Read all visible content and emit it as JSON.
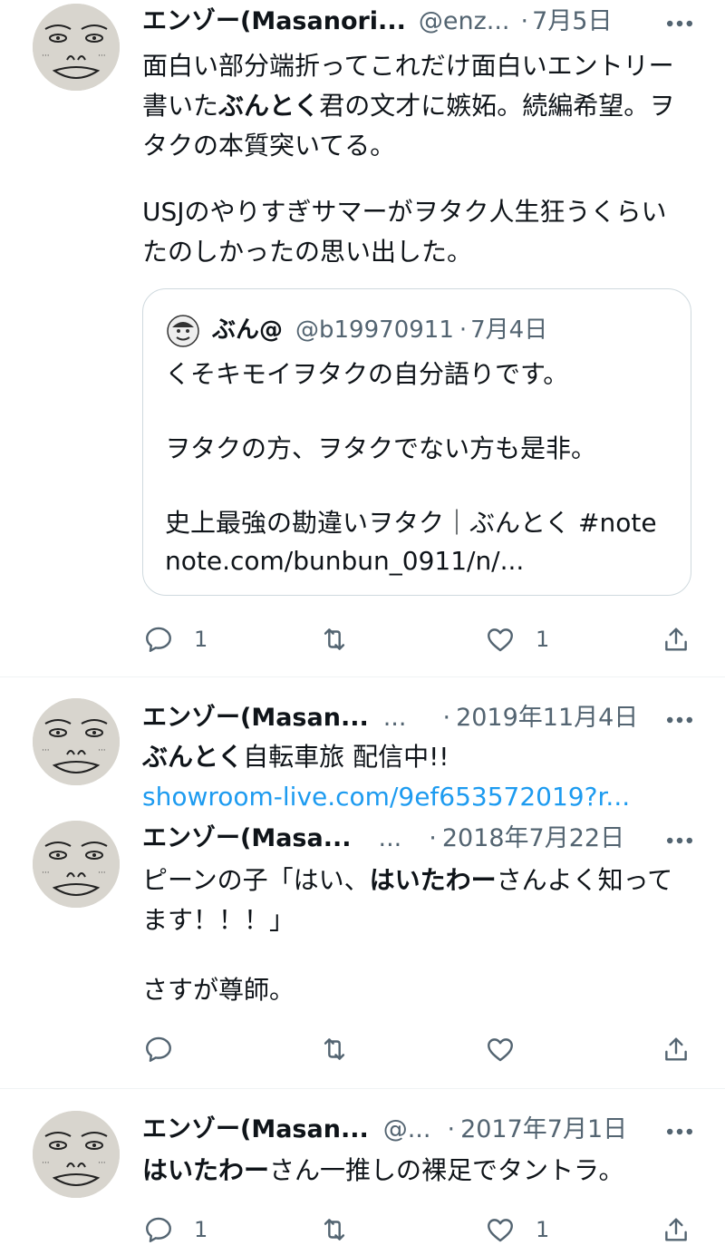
{
  "tweets": [
    {
      "author_name": "エンゾー(Masanori...",
      "handle": "@enz...",
      "sep": "·",
      "date": "7月5日",
      "lines": [
        [
          {
            "t": "面白い部分端折ってこれだけ面白いエントリー"
          }
        ],
        [
          {
            "t": "書いた"
          },
          {
            "t": "ぶんとく",
            "b": true
          },
          {
            "t": "君の文才に嫉妬。続編希望。ヲ"
          }
        ],
        [
          {
            "t": "タクの本質突いてる。"
          }
        ],
        [],
        [
          {
            "t": "USJのやりすぎサマーがヲタク人生狂うくらい"
          }
        ],
        [
          {
            "t": "たのしかったの思い出した。"
          }
        ]
      ],
      "quote": {
        "author_name": "ぶん@",
        "handle": "@b19970911",
        "sep": "·",
        "date": "7月4日",
        "line1": "くそキモイヲタクの自分語りです。",
        "line2": "ヲタクの方、ヲタクでない方も是非。",
        "line3": "史上最強の勘違いヲタク｜ぶんとく #note",
        "line4": "note.com/bunbun_0911/n/..."
      },
      "reply_count": "1",
      "retweet_count": "",
      "like_count": "1"
    },
    {
      "author_name": "エンゾー(Masan...",
      "handle": "...",
      "sep": "·",
      "date": "2019年11月4日",
      "lines": [
        [
          {
            "t": "ぶんとく",
            "b": true
          },
          {
            "t": "自転車旅 配信中!!"
          }
        ]
      ],
      "link": "showroom-live.com/9ef653572019?r..."
    },
    {
      "author_name": "エンゾー(Masa...",
      "handle": "...",
      "sep": "·",
      "date": "2018年7月22日",
      "lines": [
        [
          {
            "t": "ピーンの子「はい、"
          },
          {
            "t": "はいたわー",
            "b": true
          },
          {
            "t": "さんよく知って"
          }
        ],
        [
          {
            "t": "ます！！！」"
          }
        ],
        [],
        [
          {
            "t": "さすが尊師。"
          }
        ]
      ],
      "reply_count": "",
      "retweet_count": "",
      "like_count": ""
    },
    {
      "author_name": "エンゾー(Masan...",
      "handle": "@...",
      "sep": "·",
      "date": "2017年7月1日",
      "lines": [
        [
          {
            "t": "はいたわー",
            "b": true
          },
          {
            "t": "さん一推しの裸足でタントラ。"
          }
        ]
      ],
      "reply_count": "1",
      "retweet_count": "",
      "like_count": "1"
    }
  ],
  "colors": {
    "text": "#0f1419",
    "secondary": "#536471",
    "link": "#1d9bf0",
    "border": "#cfd9de",
    "divider": "#eff3f4"
  },
  "icons": [
    "reply-icon",
    "retweet-icon",
    "like-icon",
    "share-icon",
    "more-icon",
    "avatar"
  ]
}
